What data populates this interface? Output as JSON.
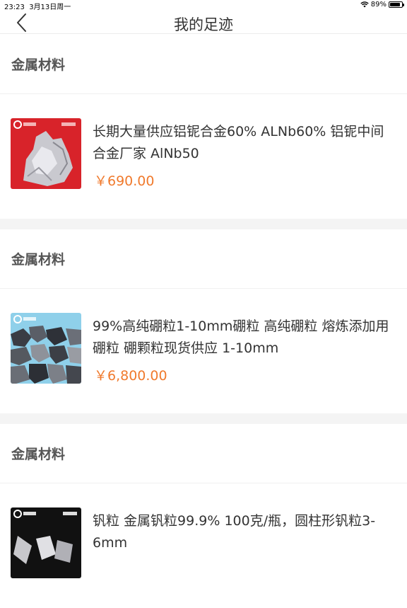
{
  "status": {
    "time": "23:23",
    "date": "3月13日周一",
    "battery": "89%",
    "battery_level": 0.89
  },
  "header": {
    "title": "我的足迹"
  },
  "items": [
    {
      "category": "金属材料",
      "title": "长期大量供应铝铌合金60% ALNb60% 铝铌中间合金厂家 AlNb50",
      "price": "￥690.00"
    },
    {
      "category": "金属材料",
      "title": "99%高纯硼粒1-10mm硼粒 高纯硼粒 熔炼添加用硼粒 硼颗粒现货供应 1-10mm",
      "price": "￥6,800.00"
    },
    {
      "category": "金属材料",
      "title": "钒粒 金属钒粒99.9% 100克/瓶，圆柱形钒粒3-6mm",
      "price": ""
    }
  ],
  "colors": {
    "price": "#f07a2d",
    "divider": "#f4f4f4"
  }
}
